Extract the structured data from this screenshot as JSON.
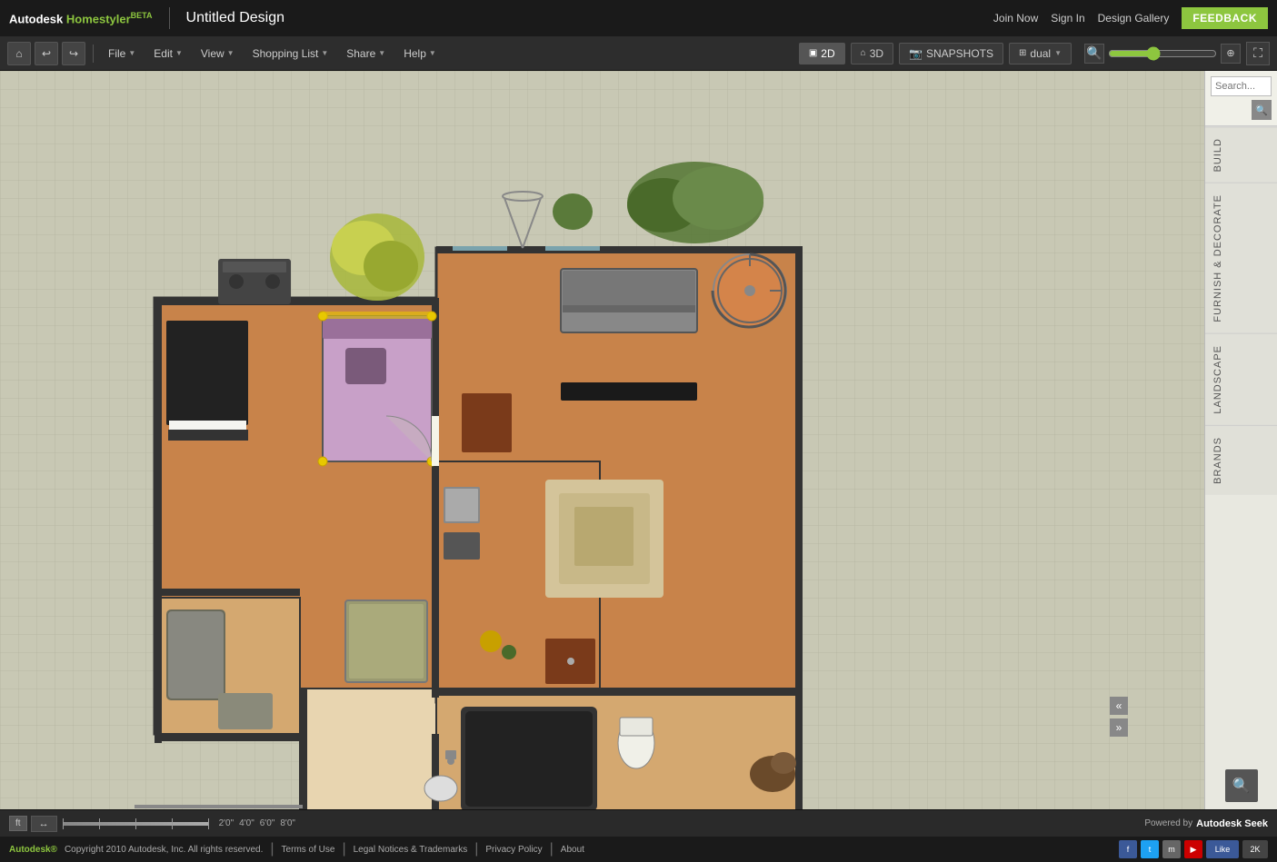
{
  "app": {
    "name": "Autodesk",
    "product": "Homestyler",
    "beta": "BETA",
    "tm": "™",
    "title": "Untitled Design"
  },
  "topnav": {
    "join": "Join Now",
    "signin": "Sign In",
    "gallery": "Design Gallery",
    "feedback": "FEEDBACK"
  },
  "toolbar": {
    "home": "⌂",
    "undo": "↩",
    "redo": "↪",
    "file": "File",
    "edit": "Edit",
    "view": "View",
    "shopping": "Shopping List",
    "share": "Share",
    "help": "Help",
    "mode2d": "2D",
    "mode3d": "3D",
    "snapshots": "SNAPSHOTS",
    "dual": "dual",
    "zoom_in": "🔍",
    "zoom_out": "🔍"
  },
  "rightpanel": {
    "search_placeholder": "Search...",
    "tabs": [
      "BUILD",
      "FURNISH & DECORATE",
      "LANDSCAPE",
      "BRANDS"
    ],
    "search_icon": "🔍"
  },
  "bottombar": {
    "unit": "ft",
    "arrow": "↔",
    "marks": [
      "2'0\"",
      "4'0\"",
      "6'0\"",
      "8'0\""
    ],
    "powered_by": "Powered by",
    "seek": "Autodesk Seek"
  },
  "footer": {
    "autodesk": "Autodesk®",
    "copyright": "Copyright 2010 Autodesk, Inc. All rights reserved.",
    "terms": "Terms of Use",
    "legal": "Legal Notices & Trademarks",
    "privacy": "Privacy Policy",
    "about": "About",
    "like": "Like",
    "count": "2K"
  }
}
